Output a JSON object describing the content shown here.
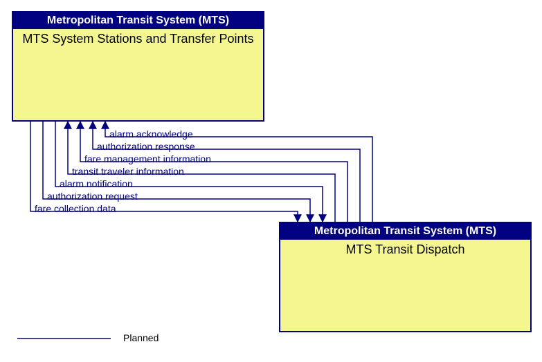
{
  "boxes": {
    "top": {
      "header": "Metropolitan Transit System (MTS)",
      "title": "MTS System Stations and Transfer Points"
    },
    "bottom": {
      "header": "Metropolitan Transit System (MTS)",
      "title": "MTS Transit Dispatch"
    }
  },
  "flows": {
    "to_top": [
      "alarm acknowledge",
      "authorization response",
      "fare management information",
      "transit traveler information"
    ],
    "to_bottom": [
      "alarm notification",
      "authorization request",
      "fare collection data"
    ]
  },
  "legend": {
    "planned": "Planned"
  }
}
